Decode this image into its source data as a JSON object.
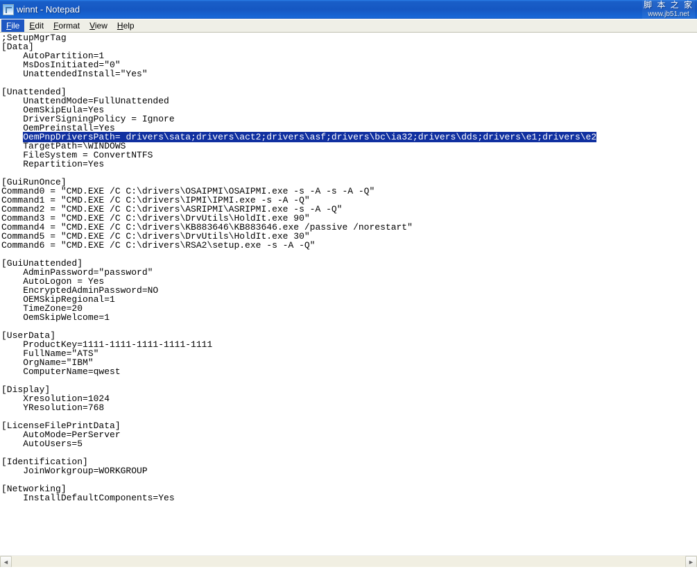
{
  "window": {
    "title": "winnt - Notepad"
  },
  "watermark": {
    "line1": "脚 本 之 家",
    "line2": "www.jb51.net"
  },
  "menu": {
    "file": "File",
    "edit": "Edit",
    "format": "Format",
    "view": "View",
    "help": "Help"
  },
  "editor": {
    "pre_selection": ";SetupMgrTag\n[Data]\n    AutoPartition=1\n    MsDosInitiated=\"0\"\n    UnattendedInstall=\"Yes\"\n\n[Unattended]\n    UnattendMode=FullUnattended\n    OemSkipEula=Yes\n    DriverSigningPolicy = Ignore\n    OemPreinstall=Yes\n    ",
    "selected": "OemPnpDriversPath= drivers\\sata;drivers\\act2;drivers\\asf;drivers\\bc\\ia32;drivers\\dds;drivers\\e1;drivers\\e2",
    "post_selection": "\n    TargetPath=\\WINDOWS\n    FileSystem = ConvertNTFS\n    Repartition=Yes\n\n[GuiRunOnce]\nCommand0 = \"CMD.EXE /C C:\\drivers\\OSAIPMI\\OSAIPMI.exe -s -A -s -A -Q\"\nCommand1 = \"CMD.EXE /C C:\\drivers\\IPMI\\IPMI.exe -s -A -Q\"\nCommand2 = \"CMD.EXE /C C:\\drivers\\ASRIPMI\\ASRIPMI.exe -s -A -Q\"\nCommand3 = \"CMD.EXE /C C:\\drivers\\DrvUtils\\HoldIt.exe 90\"\nCommand4 = \"CMD.EXE /C C:\\drivers\\KB883646\\KB883646.exe /passive /norestart\"\nCommand5 = \"CMD.EXE /C C:\\drivers\\DrvUtils\\HoldIt.exe 30\"\nCommand6 = \"CMD.EXE /C C:\\drivers\\RSA2\\setup.exe -s -A -Q\"\n\n[GuiUnattended]\n    AdminPassword=\"password\"\n    AutoLogon = Yes\n    EncryptedAdminPassword=NO\n    OEMSkipRegional=1\n    TimeZone=20\n    OemSkipWelcome=1\n\n[UserData]\n    ProductKey=1111-1111-1111-1111-1111\n    FullName=\"ATS\"\n    OrgName=\"IBM\"\n    ComputerName=qwest\n\n[Display]\n    Xresolution=1024\n    YResolution=768\n\n[LicenseFilePrintData]\n    AutoMode=PerServer\n    AutoUsers=5\n\n[Identification]\n    JoinWorkgroup=WORKGROUP\n\n[Networking]\n    InstallDefaultComponents=Yes\n"
  },
  "scroll": {
    "left_arrow": "◄",
    "right_arrow": "►"
  }
}
